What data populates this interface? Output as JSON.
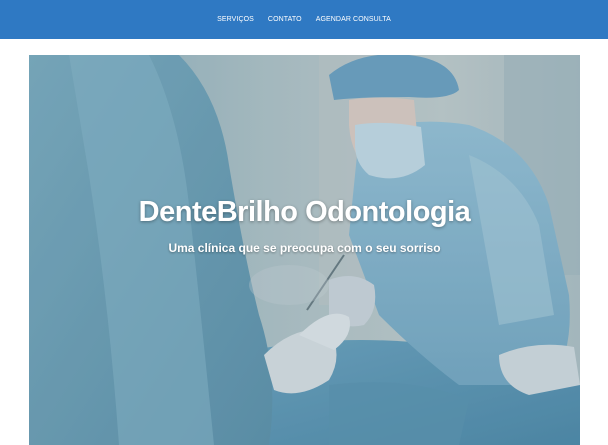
{
  "nav": {
    "items": [
      {
        "label": "SERVIÇOS"
      },
      {
        "label": "CONTATO"
      },
      {
        "label": "AGENDAR CONSULTA"
      }
    ]
  },
  "hero": {
    "title": "DenteBrilho Odontologia",
    "subtitle": "Uma clínica que se preocupa com o seu sorriso",
    "image_description_icon": "dental-surgery-photo"
  },
  "colors": {
    "nav_background": "#2f79c3",
    "hero_text": "#ffffff",
    "page_background": "#ffffff"
  }
}
